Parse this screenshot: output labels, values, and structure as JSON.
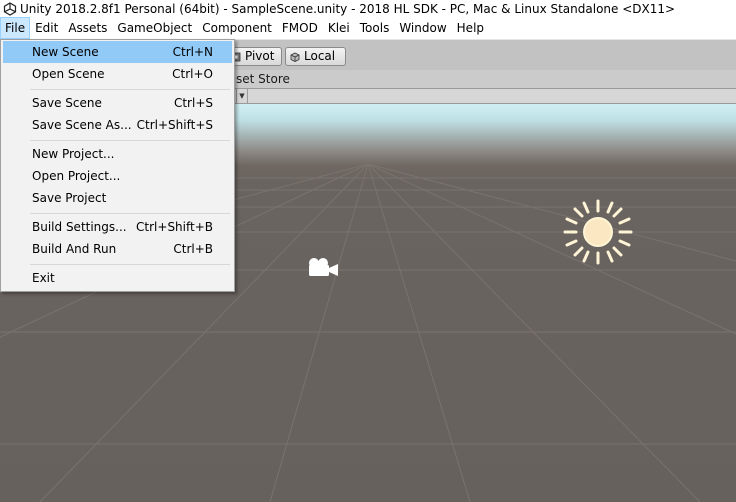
{
  "window": {
    "title": "Unity 2018.2.8f1 Personal (64bit) - SampleScene.unity - 2018 HL SDK - PC, Mac & Linux Standalone <DX11>"
  },
  "menubar": {
    "items": [
      "File",
      "Edit",
      "Assets",
      "GameObject",
      "Component",
      "FMOD",
      "Klei",
      "Tools",
      "Window",
      "Help"
    ],
    "active": "File"
  },
  "toolbar": {
    "pivot_label": "Pivot",
    "local_label": "Local"
  },
  "tabs": {
    "asset_store_partial": "set Store"
  },
  "file_menu": {
    "highlighted": "New Scene",
    "groups": [
      [
        {
          "label": "New Scene",
          "shortcut": "Ctrl+N"
        },
        {
          "label": "Open Scene",
          "shortcut": "Ctrl+O"
        }
      ],
      [
        {
          "label": "Save Scene",
          "shortcut": "Ctrl+S"
        },
        {
          "label": "Save Scene As...",
          "shortcut": "Ctrl+Shift+S"
        }
      ],
      [
        {
          "label": "New Project...",
          "shortcut": ""
        },
        {
          "label": "Open Project...",
          "shortcut": ""
        },
        {
          "label": "Save Project",
          "shortcut": ""
        }
      ],
      [
        {
          "label": "Build Settings...",
          "shortcut": "Ctrl+Shift+B"
        },
        {
          "label": "Build And Run",
          "shortcut": "Ctrl+B"
        }
      ],
      [
        {
          "label": "Exit",
          "shortcut": ""
        }
      ]
    ]
  },
  "colors": {
    "menu_highlight": "#91c9f7",
    "menubar_active": "#cce8ff",
    "scene_ground": "#67615d",
    "sky": "#cfeff3",
    "gizmo": "#fff4d6"
  },
  "icons": {
    "app": "unity-logo-icon",
    "pivot": "pivot-icon",
    "local": "local-cube-icon",
    "light": "directional-light-icon",
    "camera": "camera-icon"
  }
}
